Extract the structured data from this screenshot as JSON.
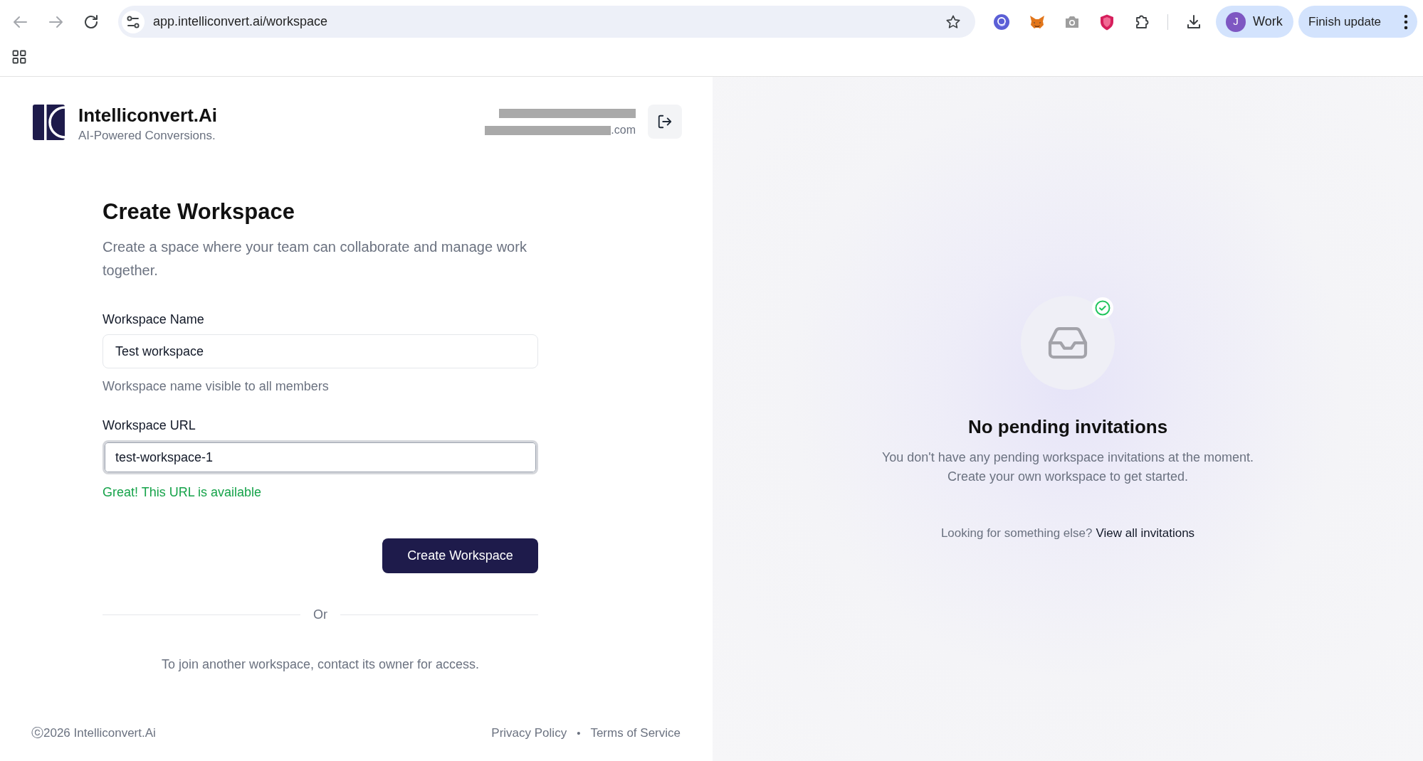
{
  "browser": {
    "url": "app.intelliconvert.ai/workspace",
    "profile": {
      "initial": "J",
      "label": "Work"
    },
    "update_button": "Finish update"
  },
  "header": {
    "brand": "Intelliconvert.Ai",
    "tagline": "AI-Powered Conversions.",
    "account_email_end": ".com"
  },
  "form": {
    "title": "Create Workspace",
    "description": "Create a space where your team can collaborate and manage work together.",
    "fields": [
      {
        "label": "Workspace Name",
        "value": "Test workspace",
        "focused": false,
        "hint": "Workspace name visible to all members",
        "success": false
      },
      {
        "label": "Workspace URL",
        "value": "test-workspace-1",
        "focused": true,
        "hint": "Great! This URL is available",
        "success": true
      }
    ],
    "submit_button": "Create Workspace",
    "divider": "Or",
    "join_note": "To join another workspace, contact its owner for access."
  },
  "footer": {
    "copyright": "ⓒ2026 Intelliconvert.Ai",
    "links": [
      "Privacy Policy",
      "Terms of Service"
    ],
    "separator": "•"
  },
  "invitations": {
    "title": "No pending invitations",
    "description": "You don't have any pending workspace invitations at the moment. Create your own workspace to get started.",
    "prompt": "Looking for something else?",
    "link": "View all invitations"
  }
}
